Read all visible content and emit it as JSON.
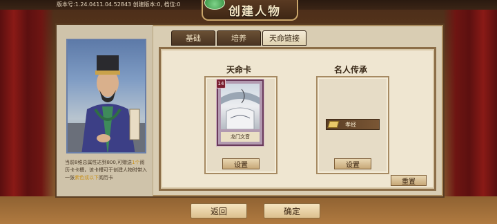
{
  "header": {
    "version_text": "版本号:1.24.0411.04.52843 创建版本:0, 档位:0",
    "title": "创建人物"
  },
  "tabs": [
    {
      "label": "基础"
    },
    {
      "label": "培养"
    },
    {
      "label": "天命链接"
    }
  ],
  "left": {
    "description_parts": [
      "当前8维总属性达到800,可赠送",
      "1个",
      "阅历卡卡槽，该卡槽可于创建人物时带入一张",
      "紫色或以下",
      "阅历卡"
    ]
  },
  "fate_card": {
    "section_title": "天命卡",
    "card_name": "龙门文音",
    "card_level": "14",
    "set_label": "设置"
  },
  "inheritance": {
    "section_title": "名人传承",
    "item_label": "孝经",
    "set_label": "设置",
    "reset_label": "重置"
  },
  "footer": {
    "back_label": "返回",
    "confirm_label": "确定"
  },
  "colors": {
    "highlight": "#c9921e",
    "active_tab": "#efe6d1"
  }
}
